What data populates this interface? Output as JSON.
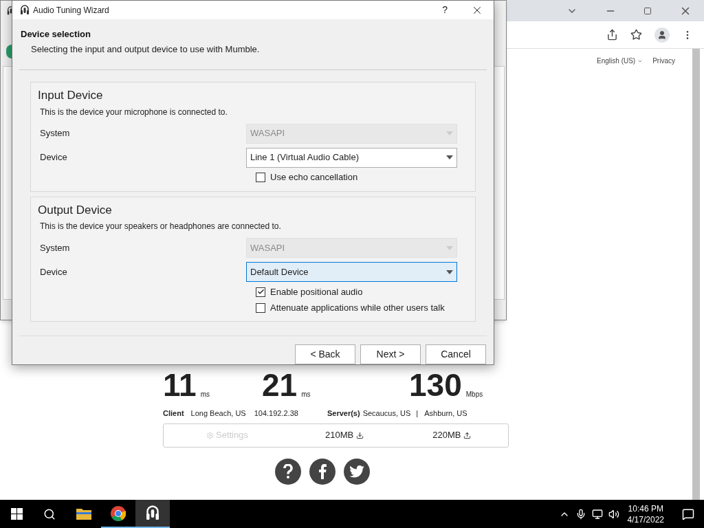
{
  "browser": {
    "header_links": [
      {
        "label": "English (US)",
        "kind": "dropdown"
      },
      {
        "label": "Privacy",
        "kind": "link"
      }
    ],
    "results": [
      {
        "value": "11",
        "unit": "ms"
      },
      {
        "value": "21",
        "unit": "ms"
      },
      {
        "value": "130",
        "unit": "Mbps"
      }
    ],
    "client": {
      "label": "Client",
      "location": "Long Beach, US",
      "ip": "104.192.2.38"
    },
    "servers": {
      "label": "Server(s)",
      "list": [
        "Secaucus, US",
        "Ashburn, US"
      ],
      "separator": "|"
    },
    "settings_bar": {
      "settings": "Settings",
      "download": "210MB",
      "upload": "220MB"
    }
  },
  "dialog": {
    "title": "Audio Tuning Wizard",
    "help": "?",
    "heading": "Device selection",
    "subheading": "Selecting the input and output device to use with Mumble.",
    "groups": [
      {
        "title": "Input Device",
        "description": "This is the device your microphone is connected to.",
        "rows": [
          {
            "kind": "combo",
            "label": "System",
            "value": "WASAPI",
            "disabled": true,
            "focused": false
          },
          {
            "kind": "combo",
            "label": "Device",
            "value": "Line 1 (Virtual Audio Cable)",
            "disabled": false,
            "focused": false
          },
          {
            "kind": "checkbox",
            "label": "Use echo cancellation",
            "checked": false
          }
        ]
      },
      {
        "title": "Output Device",
        "description": "This is the device your speakers or headphones are connected to.",
        "rows": [
          {
            "kind": "combo",
            "label": "System",
            "value": "WASAPI",
            "disabled": true,
            "focused": false
          },
          {
            "kind": "combo",
            "label": "Device",
            "value": "Default Device",
            "disabled": false,
            "focused": true
          },
          {
            "kind": "checkbox",
            "label": "Enable positional audio",
            "checked": true
          },
          {
            "kind": "checkbox",
            "label": "Attenuate applications while other users talk",
            "checked": false
          }
        ]
      }
    ],
    "buttons": [
      "< Back",
      "Next >",
      "Cancel"
    ]
  },
  "taskbar": {
    "time": "10:46 PM",
    "date": "4/17/2022",
    "apps": [
      {
        "kind": "explorer",
        "running": false
      },
      {
        "kind": "chrome",
        "running": true
      },
      {
        "kind": "mumble",
        "running": true
      }
    ]
  }
}
